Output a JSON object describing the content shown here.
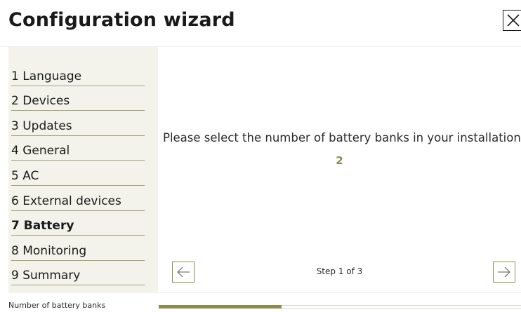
{
  "wizard": {
    "title": "Configuration wizard",
    "close_icon": "close-icon"
  },
  "steps": [
    {
      "label": "1 Language",
      "active": false
    },
    {
      "label": "2 Devices",
      "active": false
    },
    {
      "label": "3 Updates",
      "active": false
    },
    {
      "label": "4 General",
      "active": false
    },
    {
      "label": "5 AC",
      "active": false
    },
    {
      "label": "6 External devices",
      "active": false
    },
    {
      "label": "7 Battery",
      "active": true
    },
    {
      "label": "8 Monitoring",
      "active": false
    },
    {
      "label": "9 Summary",
      "active": false
    }
  ],
  "main": {
    "question": "Please select the number of battery banks in your installation",
    "value": "2",
    "step_counter": "Step 1 of 3",
    "prev_icon": "arrow-left-icon",
    "next_icon": "arrow-right-icon"
  },
  "footer": {
    "label": "Number of battery banks",
    "progress_fraction": 0.34
  },
  "colors": {
    "accent": "#8c8a4c",
    "sidebar_bg": "#f3f3ec",
    "divider": "#a3a17a"
  }
}
